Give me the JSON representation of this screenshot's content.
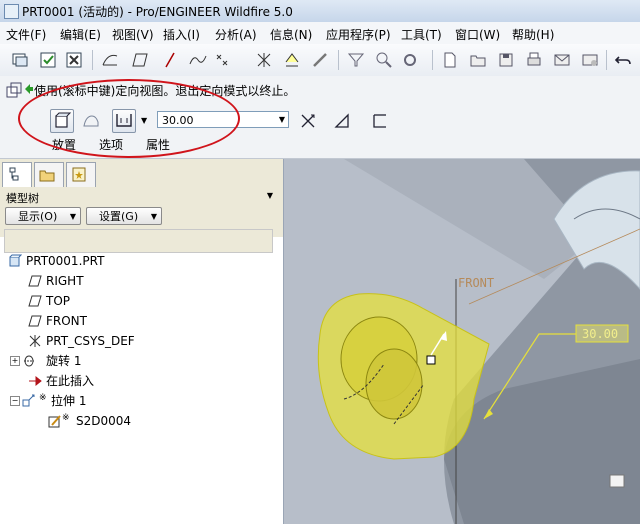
{
  "window": {
    "title": "PRT0001 (活动的) - Pro/ENGINEER Wildfire 5.0"
  },
  "menu": [
    {
      "label": "文件(F)"
    },
    {
      "label": "编辑(E)"
    },
    {
      "label": "视图(V)"
    },
    {
      "label": "插入(I)"
    },
    {
      "label": "分析(A)"
    },
    {
      "label": "信息(N)"
    },
    {
      "label": "应用程序(P)"
    },
    {
      "label": "工具(T)"
    },
    {
      "label": "窗口(W)"
    },
    {
      "label": "帮助(H)"
    }
  ],
  "dashboard": {
    "prompt": "使用(滚标中键)定向视图。退出定向模式以终止。",
    "depth_value": "30.00",
    "tabs": [
      {
        "label": "放置"
      },
      {
        "label": "选项"
      },
      {
        "label": "属性"
      }
    ]
  },
  "model_tree": {
    "title": "模型树",
    "show_button": "显示(O)",
    "settings_button": "设置(G)",
    "items": [
      {
        "label": "PRT0001.PRT"
      },
      {
        "label": "RIGHT"
      },
      {
        "label": "TOP"
      },
      {
        "label": "FRONT"
      },
      {
        "label": "PRT_CSYS_DEF"
      },
      {
        "label": "旋转 1"
      },
      {
        "label": "在此插入"
      },
      {
        "label": "拉伸 1"
      },
      {
        "label": "S2D0004"
      }
    ]
  },
  "graphics": {
    "front_label": "FRONT",
    "dimension": "30.00"
  },
  "colors": {
    "highlight": "#e6e03a",
    "annotation_circle": "#d0141b",
    "datum_label": "#b58a5a"
  }
}
